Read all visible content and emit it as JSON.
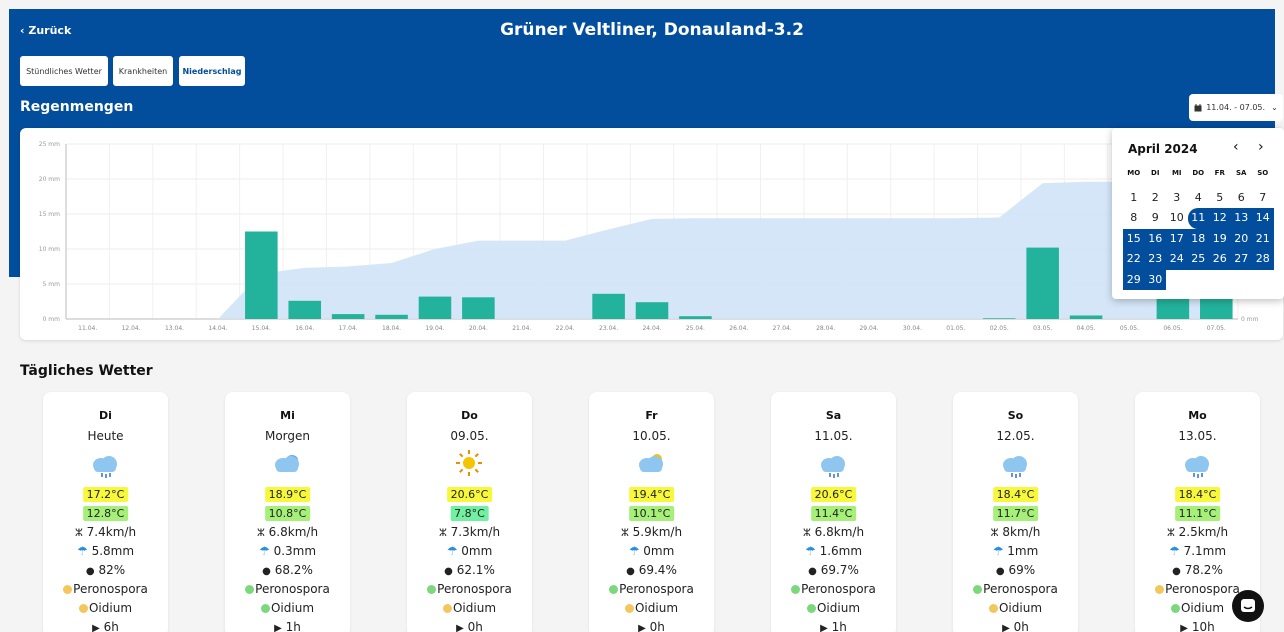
{
  "header": {
    "back_label": "‹ Zurück",
    "title": "Grüner Veltliner, Donauland-3.2"
  },
  "tabs": [
    {
      "label": "Stündliches Wetter",
      "active": false
    },
    {
      "label": "Krankheiten",
      "active": false
    },
    {
      "label": "Niederschlag",
      "active": true
    }
  ],
  "section_title": "Regenmengen",
  "date_range": {
    "icon": "calendar-icon",
    "label": "11.04. - 07.05."
  },
  "chart_data": {
    "type": "bar",
    "categories": [
      "11.04.",
      "12.04.",
      "13.04.",
      "14.04.",
      "15.04.",
      "16.04.",
      "17.04.",
      "18.04.",
      "19.04.",
      "20.04.",
      "21.04.",
      "22.04.",
      "23.04.",
      "24.04.",
      "25.04.",
      "26.04.",
      "27.04.",
      "28.04.",
      "29.04.",
      "30.04.",
      "01.05.",
      "02.05.",
      "03.05.",
      "04.05.",
      "05.05.",
      "06.05.",
      "07.05."
    ],
    "series": [
      {
        "values": [
          0,
          0,
          0,
          0,
          12.5,
          2.6,
          0.7,
          0.6,
          3.2,
          3.1,
          0,
          0,
          3.6,
          2.4,
          0.4,
          0,
          0,
          0,
          0,
          0,
          0,
          0.1,
          10.2,
          0.5,
          0,
          5.8,
          3.0
        ],
        "color": "#23b29b"
      },
      {
        "values": [
          0,
          0,
          0,
          0,
          6.5,
          7.3,
          7.5,
          8.0,
          10.0,
          11.2,
          11.2,
          11.2,
          12.8,
          14.3,
          14.4,
          14.4,
          14.4,
          14.4,
          14.4,
          14.4,
          14.4,
          14.5,
          19.4,
          19.6,
          19.6,
          19.6,
          19.6
        ],
        "color": "#cfe3f7"
      }
    ],
    "y_ticks": [
      "0 mm",
      "5 mm",
      "10 mm",
      "15 mm",
      "20 mm",
      "25 mm"
    ],
    "right_axis_label": "0 mm",
    "ylim": [
      0,
      25
    ],
    "grid": true
  },
  "calendar": {
    "month": "April 2024",
    "prev_icon": "‹",
    "next_icon": "›",
    "weekdays": [
      "MO",
      "DI",
      "MI",
      "DO",
      "FR",
      "SA",
      "SO"
    ],
    "days": [
      "1",
      "2",
      "3",
      "4",
      "5",
      "6",
      "7",
      "8",
      "9",
      "10",
      "11",
      "12",
      "13",
      "14",
      "15",
      "16",
      "17",
      "18",
      "19",
      "20",
      "21",
      "22",
      "23",
      "24",
      "25",
      "26",
      "27",
      "28",
      "29",
      "30"
    ],
    "selected_from": 11
  },
  "daily_title": "Tägliches Wetter",
  "days": [
    {
      "name": "Di",
      "date": "Heute",
      "icon": "rain-cloud-icon",
      "tmax": "17.2°C",
      "tmin": "12.8°C",
      "tmin_color": "#a6f07a",
      "wind": "7.4km/h",
      "rain": "5.8mm",
      "humidity": "82%",
      "peronospora": "Peronospora",
      "pero_color": "#f2c75c",
      "oidium": "Oidium",
      "oid_color": "#f2c75c",
      "sun": "6h"
    },
    {
      "name": "Mi",
      "date": "Morgen",
      "icon": "cloudy-icon",
      "tmax": "18.9°C",
      "tmin": "10.8°C",
      "tmin_color": "#a6f07a",
      "wind": "6.8km/h",
      "rain": "0.3mm",
      "humidity": "68.2%",
      "peronospora": "Peronospora",
      "pero_color": "#7dd87d",
      "oidium": "Oidium",
      "oid_color": "#7dd87d",
      "sun": "1h"
    },
    {
      "name": "Do",
      "date": "09.05.",
      "icon": "sun-icon",
      "tmax": "20.6°C",
      "tmin": "7.8°C",
      "tmin_color": "#70f0a0",
      "wind": "7.3km/h",
      "rain": "0mm",
      "humidity": "62.1%",
      "peronospora": "Peronospora",
      "pero_color": "#7dd87d",
      "oidium": "Oidium",
      "oid_color": "#f2c75c",
      "sun": "0h"
    },
    {
      "name": "Fr",
      "date": "10.05.",
      "icon": "partly-cloudy-icon",
      "tmax": "19.4°C",
      "tmin": "10.1°C",
      "tmin_color": "#a6f07a",
      "wind": "5.9km/h",
      "rain": "0mm",
      "humidity": "69.4%",
      "peronospora": "Peronospora",
      "pero_color": "#7dd87d",
      "oidium": "Oidium",
      "oid_color": "#f2c75c",
      "sun": "0h"
    },
    {
      "name": "Sa",
      "date": "11.05.",
      "icon": "showers-icon",
      "tmax": "20.6°C",
      "tmin": "11.4°C",
      "tmin_color": "#a6f07a",
      "wind": "6.8km/h",
      "rain": "1.6mm",
      "humidity": "69.7%",
      "peronospora": "Peronospora",
      "pero_color": "#7dd87d",
      "oidium": "Oidium",
      "oid_color": "#7dd87d",
      "sun": "1h"
    },
    {
      "name": "So",
      "date": "12.05.",
      "icon": "showers-icon",
      "tmax": "18.4°C",
      "tmin": "11.7°C",
      "tmin_color": "#a6f07a",
      "wind": "8km/h",
      "rain": "1mm",
      "humidity": "69%",
      "peronospora": "Peronospora",
      "pero_color": "#7dd87d",
      "oidium": "Oidium",
      "oid_color": "#f2c75c",
      "sun": "0h"
    },
    {
      "name": "Mo",
      "date": "13.05.",
      "icon": "rain-cloud-icon",
      "tmax": "18.4°C",
      "tmin": "11.1°C",
      "tmin_color": "#a6f07a",
      "wind": "2.5km/h",
      "rain": "7.1mm",
      "humidity": "78.2%",
      "peronospora": "Peronospora",
      "pero_color": "#f2c75c",
      "oidium": "Oidium",
      "oid_color": "#7dd87d",
      "sun": "10h"
    }
  ],
  "colors": {
    "brand": "#024d9c",
    "bar": "#23b29b",
    "area": "#cfe3f7"
  }
}
